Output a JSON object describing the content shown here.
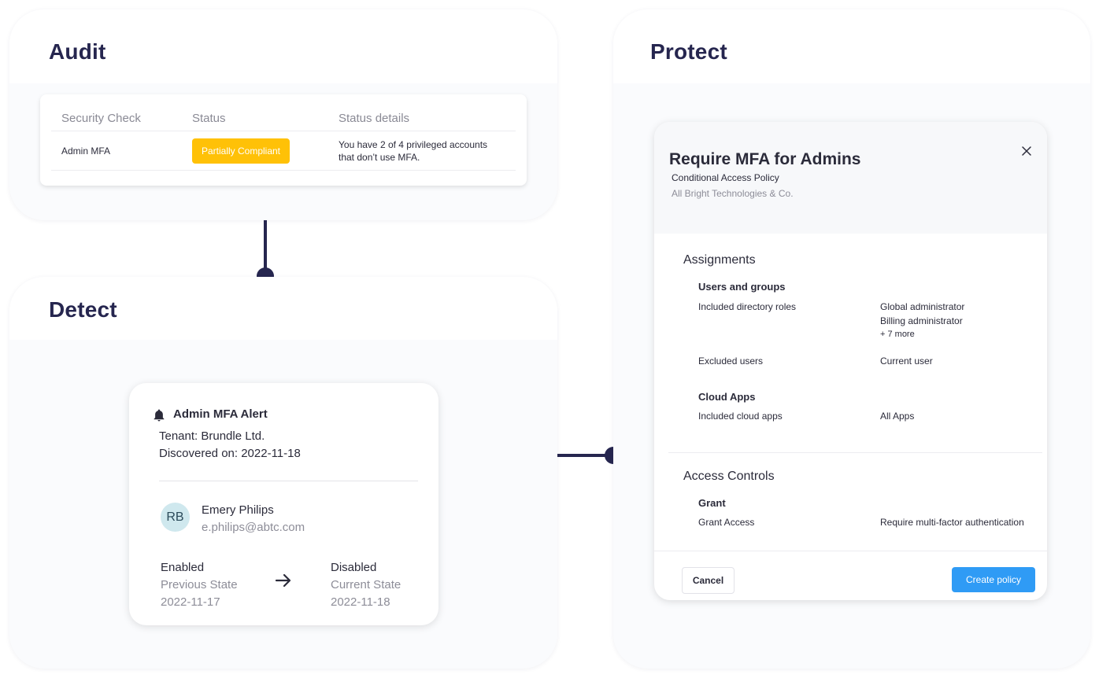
{
  "audit": {
    "title": "Audit",
    "columns": [
      "Security Check",
      "Status",
      "Status details"
    ],
    "row": {
      "check": "Admin MFA",
      "status": "Partially Compliant",
      "details_line1": "You have 2 of 4 privileged accounts",
      "details_line2": "that don’t use MFA."
    },
    "status_color": "#ffc107"
  },
  "detect": {
    "title": "Detect",
    "alert": {
      "title": "Admin MFA Alert",
      "tenant": "Tenant: Brundle Ltd.",
      "discovered": "Discovered on: 2022-11-18",
      "user_initials": "RB",
      "user_name": "Emery Philips",
      "user_email": "e.philips@abtc.com",
      "prev_value": "Enabled",
      "prev_label": "Previous State",
      "prev_date": "2022-11-17",
      "curr_value": "Disabled",
      "curr_label": "Current State",
      "curr_date": "2022-11-18"
    }
  },
  "protect": {
    "title": "Protect",
    "policy": {
      "title": "Require MFA for Admins",
      "subtitle": "Conditional Access Policy",
      "org": "All Bright Technologies & Co.",
      "assignments_title": "Assignments",
      "users_groups_title": "Users and groups",
      "included_roles_label": "Included directory roles",
      "included_roles": [
        "Global administrator",
        "Billing administrator"
      ],
      "more_roles": "+ 7 more",
      "excluded_users_label": "Excluded users",
      "excluded_users_value": "Current user",
      "cloud_apps_title": "Cloud Apps",
      "included_apps_label": "Included cloud apps",
      "included_apps_value": "All Apps",
      "access_controls_title": "Access Controls",
      "grant_title": "Grant",
      "grant_access_label": "Grant Access",
      "grant_access_value": "Require multi-factor authentication",
      "cancel_label": "Cancel",
      "create_label": "Create policy"
    },
    "accent_color": "#2f9bf5"
  },
  "connector_color": "#26264f"
}
